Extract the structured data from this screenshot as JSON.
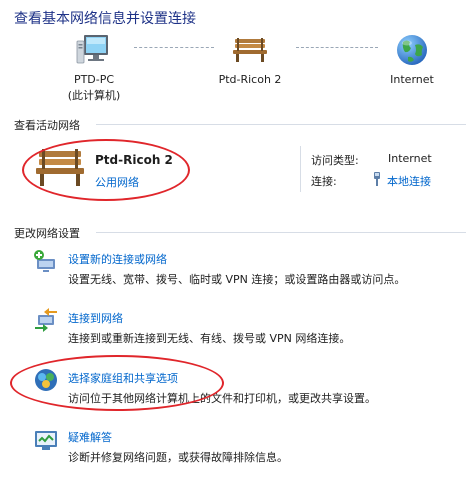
{
  "title": "查看基本网络信息并设置连接",
  "network_map": {
    "nodes": [
      {
        "line1": "PTD-PC",
        "line2": "(此计算机)",
        "icon": "computer-icon"
      },
      {
        "line1": "Ptd-Ricoh  2",
        "line2": "",
        "icon": "park-bench-icon"
      },
      {
        "line1": "Internet",
        "line2": "",
        "icon": "globe-icon"
      }
    ]
  },
  "active_networks": {
    "heading": "查看活动网络",
    "name": "Ptd-Ricoh  2",
    "type_link": "公用网络",
    "access_type_label": "访问类型:",
    "access_type_value": "Internet",
    "connection_label": "连接:",
    "connection_value": "本地连接"
  },
  "change_settings": {
    "heading": "更改网络设置",
    "tasks": [
      {
        "title": "设置新的连接或网络",
        "desc": "设置无线、宽带、拨号、临时或 VPN 连接；或设置路由器或访问点。",
        "icon": "new-connection-icon"
      },
      {
        "title": "连接到网络",
        "desc": "连接到或重新连接到无线、有线、拨号或 VPN 网络连接。",
        "icon": "connect-network-icon"
      },
      {
        "title": "选择家庭组和共享选项",
        "desc": "访问位于其他网络计算机上的文件和打印机，或更改共享设置。",
        "icon": "homegroup-icon"
      },
      {
        "title": "疑难解答",
        "desc": "诊断并修复网络问题，或获得故障排除信息。",
        "icon": "troubleshoot-icon"
      }
    ]
  },
  "colors": {
    "title": "#1e3287",
    "link": "#0066cc",
    "annotation": "#e0262b"
  }
}
